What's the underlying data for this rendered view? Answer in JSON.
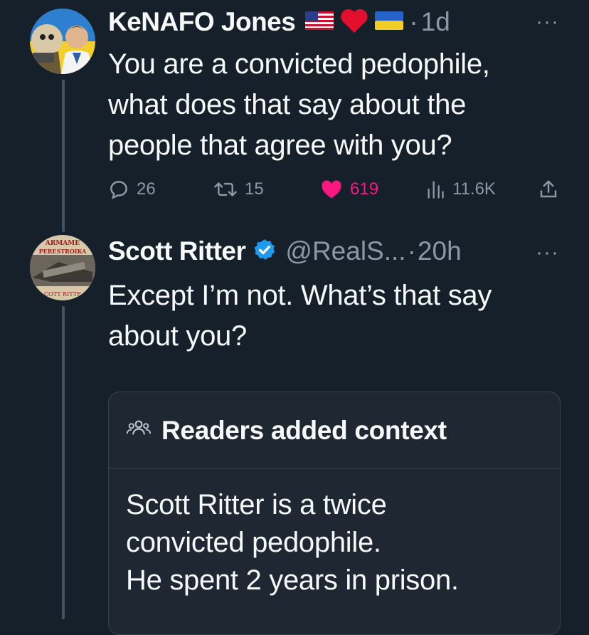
{
  "tweet1": {
    "author_name": "KeNAFO Jones",
    "name_emoji": [
      "us-flag-icon",
      "heart-icon",
      "ukraine-flag-icon"
    ],
    "separator": "·",
    "time": "1d",
    "more": "···",
    "text_lines": [
      "You are a convicted pedophile,",
      "what does that say about the",
      "people that agree with you?"
    ],
    "actions": {
      "replies": "26",
      "retweets": "15",
      "likes": "619",
      "views": "11.6K"
    }
  },
  "tweet2": {
    "author_name": "Scott Ritter",
    "handle": "@RealS...",
    "separator": "·",
    "time": "20h",
    "more": "···",
    "text_lines": [
      "Except I’m not. What’s that say",
      "about you?"
    ],
    "avatar_text": {
      "top": "ARMAME",
      "middle": "PERESTROIKA",
      "bottom": "COTT RITTE"
    }
  },
  "community_note": {
    "title": "Readers added context",
    "lines": [
      "Scott Ritter is a twice",
      "convicted pedophile.",
      "He spent 2 years in prison."
    ]
  },
  "colors": {
    "background": "#15202b",
    "text": "#f7f9f9",
    "muted": "#8b98a5",
    "like": "#f91880",
    "verified": "#1d9bf0"
  }
}
